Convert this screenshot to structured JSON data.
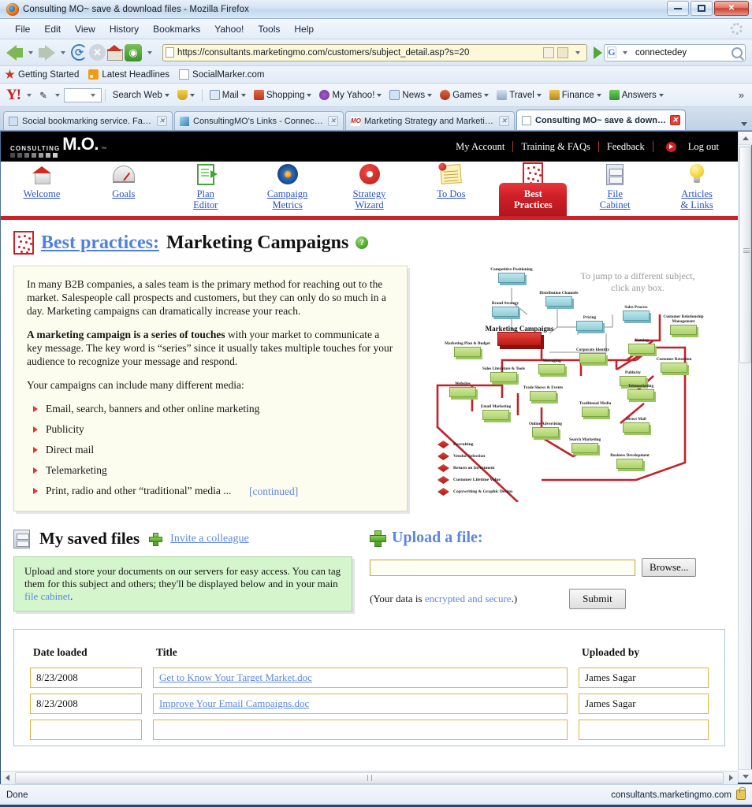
{
  "browser": {
    "window_title": "Consulting MO~ save & download files - Mozilla Firefox",
    "window_buttons": {
      "minimize": "minimize",
      "maximize": "maximize",
      "close": "close"
    },
    "menu": [
      "File",
      "Edit",
      "View",
      "History",
      "Bookmarks",
      "Yahoo!",
      "Tools",
      "Help"
    ],
    "url": "https://consultants.marketingmo.com/customers/subject_detail.asp?s=20",
    "search_value": "connectedey",
    "search_placeholder": "",
    "bookmarks": [
      "Getting Started",
      "Latest Headlines",
      "SocialMarker.com"
    ],
    "yahoo_toolbar": {
      "logo": "Y!",
      "search_value": "",
      "items": [
        "Search Web",
        "Mail",
        "Shopping",
        "My Yahoo!",
        "News",
        "Games",
        "Travel",
        "Finance",
        "Answers"
      ],
      "overflow": "»"
    },
    "tabs": [
      {
        "label": "Social bookmarking service. Fast t...",
        "active": false
      },
      {
        "label": "ConsultingMO's Links - Connecte...",
        "active": false
      },
      {
        "label": "Marketing Strategy and Marketin...",
        "active": false
      },
      {
        "label": "Consulting MO~ save & downlo...",
        "active": true
      }
    ],
    "status": {
      "left": "Done",
      "right": "consultants.marketingmo.com"
    }
  },
  "site": {
    "logo": {
      "top": "CONSULTING",
      "main": "M.O.",
      "tm": "™"
    },
    "header_links": [
      "My Account",
      "Training & FAQs",
      "Feedback"
    ],
    "logout": "Log out",
    "nav": [
      {
        "label_1": "Welcome",
        "label_2": "",
        "icon": "home-icon",
        "active": false
      },
      {
        "label_1": "Goals",
        "label_2": "",
        "icon": "gauge-icon",
        "active": false
      },
      {
        "label_1": "Plan",
        "label_2": "Editor",
        "icon": "document-icon",
        "active": false
      },
      {
        "label_1": "Campaign",
        "label_2": "Metrics",
        "icon": "target-icon",
        "active": false
      },
      {
        "label_1": "Strategy",
        "label_2": "Wizard",
        "icon": "compass-icon",
        "active": false
      },
      {
        "label_1": "To Dos",
        "label_2": "",
        "icon": "notepad-icon",
        "active": false
      },
      {
        "label_1": "Best",
        "label_2": "Practices",
        "icon": "bestpractices-icon",
        "active": true
      },
      {
        "label_1": "File",
        "label_2": "Cabinet",
        "icon": "filecabinet-icon",
        "active": false
      },
      {
        "label_1": "Articles",
        "label_2": "& Links",
        "icon": "lightbulb-icon",
        "active": false
      }
    ]
  },
  "page": {
    "title_link": "Best practices:",
    "title_rest": "Marketing Campaigns",
    "help_glyph": "?",
    "intro_p1": "In many B2B companies, a sales team is the primary method for reaching out to the market. Salespeople call prospects and customers, but they can only do so much in a day. Marketing campaigns can dramatically increase your reach.",
    "intro_p2_bold": "A marketing campaign is a series of touches",
    "intro_p2_rest": " with your market to communicate a key message. The key word is “series” since it usually takes multiple touches for your audience to recognize your message and respond.",
    "intro_p3": "Your campaigns can include many different media:",
    "media_list": [
      "Email, search, banners and other online marketing",
      "Publicity",
      "Direct mail",
      "Telemarketing",
      "Print, radio and other “traditional” media ..."
    ],
    "continued_link": "[continued]",
    "diagram": {
      "hint": "To jump to a different subject, click any box.",
      "center_label": "Marketing Campaigns",
      "blue_nodes": [
        "Competitive Positioning",
        "Brand Strategy",
        "Distribution Channels",
        "Pricing",
        "Sales Process"
      ],
      "green_nodes": [
        "Marketing Plan & Budget",
        "Corporate Identity",
        "Naming",
        "Customer Relationship Management",
        "Sales Literature & Tools",
        "Messaging",
        "Publicity",
        "Customer Retention",
        "Websites",
        "Email Marketing",
        "Trade Shows & Events",
        "Traditional Media",
        "Telemarketing",
        "Online Advertising",
        "Search Marketing",
        "Direct Mail",
        "Business Development"
      ],
      "legend": [
        "Recruiting",
        "Vendor Selection",
        "Return on Investment",
        "Customer Lifetime Value",
        "Copywriting & Graphic Design"
      ]
    },
    "saved_files": {
      "heading": "My saved files",
      "invite_link": "Invite a colleague",
      "note_a": "Upload and store your documents on our servers for easy access. You can tag them for this subject and others; they'll be displayed below and in your main ",
      "note_link": "file cabinet",
      "note_b": "."
    },
    "upload": {
      "heading": "Upload a file:",
      "file_value": "",
      "file_placeholder": "",
      "browse_label": "Browse...",
      "secure_prefix": "(Your data is ",
      "secure_link": "encrypted and secure",
      "secure_suffix": ".)",
      "submit_label": "Submit"
    },
    "table": {
      "headers": [
        "Date loaded",
        "Title",
        "Uploaded by"
      ],
      "rows": [
        {
          "date": "8/23/2008",
          "title": "Get to Know Your Target Market.doc",
          "by": "James Sagar"
        },
        {
          "date": "8/23/2008",
          "title": "Improve Your Email Campaigns.doc",
          "by": "James Sagar"
        }
      ]
    }
  },
  "colors": {
    "brand_red": "#cf1f27",
    "link_blue": "#5b87e3",
    "info_bg": "#fdfdef",
    "green_bg": "#d5f5cd",
    "field_border": "#e3b23c"
  }
}
